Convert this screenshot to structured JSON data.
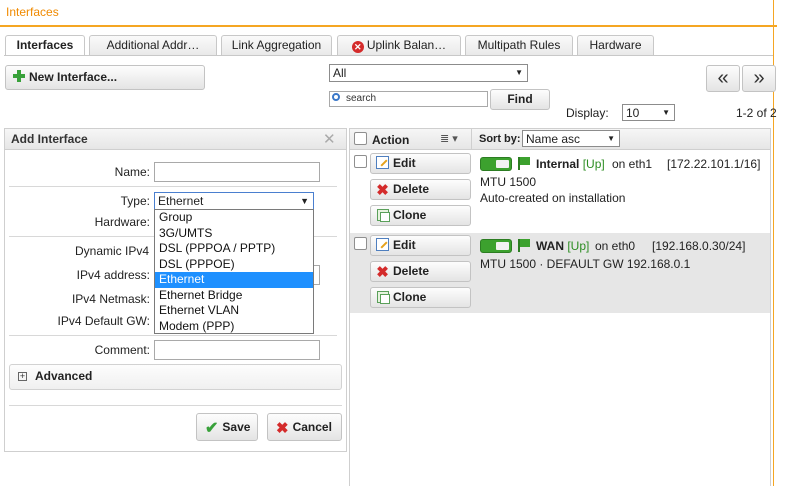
{
  "page_title": "Interfaces",
  "tabs": [
    {
      "label": "Interfaces",
      "active": true
    },
    {
      "label": "Additional Addr…",
      "active": false
    },
    {
      "label": "Link Aggregation",
      "active": false
    },
    {
      "label": "Uplink Balan…",
      "active": false,
      "icon": "error-icon"
    },
    {
      "label": "Multipath Rules",
      "active": false
    },
    {
      "label": "Hardware",
      "active": false
    }
  ],
  "toolbar": {
    "new_label": "New Interface...",
    "filter_value": "All",
    "search_placeholder": "search",
    "find_label": "Find",
    "display_label": "Display:",
    "display_value": "10",
    "page_info": "1-2 of 2",
    "prev_label": "«",
    "next_label": "»"
  },
  "form": {
    "title": "Add Interface",
    "name_label": "Name:",
    "name_value": "",
    "type_label": "Type:",
    "type_value": "Ethernet",
    "hardware_label": "Hardware:",
    "dynamic_label": "Dynamic IPv4",
    "ipv4_address_label": "IPv4 address:",
    "ipv4_netmask_label": "IPv4 Netmask:",
    "ipv4_gw_label": "IPv4 Default GW:",
    "comment_label": "Comment:",
    "comment_value": "",
    "advanced_label": "Advanced",
    "save_label": "Save",
    "cancel_label": "Cancel",
    "type_options": [
      "Group",
      "3G/UMTS",
      "DSL (PPPOA / PPTP)",
      "DSL (PPPOE)",
      "Ethernet",
      "Ethernet Bridge",
      "Ethernet VLAN",
      "Modem (PPP)"
    ],
    "type_selected_index": 4
  },
  "list": {
    "action_label": "Action",
    "sortby_label": "Sort by:",
    "sortby_value": "Name asc",
    "edit_label": "Edit",
    "delete_label": "Delete",
    "clone_label": "Clone",
    "rows": [
      {
        "name": "Internal",
        "status": "[Up]",
        "on": "on eth1",
        "address": "[172.22.101.1/16]",
        "line2": "MTU 1500",
        "line3": "Auto-created on installation",
        "enabled": true
      },
      {
        "name": "WAN",
        "status": "[Up]",
        "on": "on eth0",
        "address": "[192.168.0.30/24]",
        "line2": "MTU 1500 · DEFAULT GW 192.168.0.1",
        "line3": "",
        "enabled": true
      }
    ]
  },
  "colors": {
    "accent": "#f08a00",
    "status_up": "#2c8d22",
    "selected": "#1e90ff",
    "row_alt": "#e6e6e6"
  }
}
